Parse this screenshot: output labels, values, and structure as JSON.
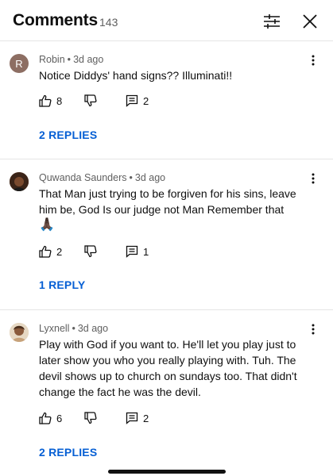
{
  "header": {
    "title": "Comments",
    "count": "143",
    "filter_icon": "sliders-icon",
    "close_icon": "close-icon"
  },
  "comments": [
    {
      "author": "Robin",
      "separator": "•",
      "time": "3d ago",
      "avatar_letter": "R",
      "text": "Notice Diddys' hand signs?? Illuminati!!",
      "likes": "8",
      "replies_count": "2",
      "view_replies": "2 REPLIES"
    },
    {
      "author": "Quwanda Saunders",
      "separator": "•",
      "time": "3d ago",
      "text": "That Man just trying to be forgiven for his sins, leave him be, God Is our judge not Man Remember that",
      "emoji": "🙏🏿",
      "likes": "2",
      "replies_count": "1",
      "view_replies": "1 REPLY"
    },
    {
      "author": "Lyxnell",
      "separator": "•",
      "time": "3d ago",
      "text": "Play with God if you want to. He'll let you play just to later show you who you really playing with. Tuh. The devil shows up to church on sundays too. That didn't change the fact he was the devil.",
      "likes": "6",
      "replies_count": "2",
      "view_replies": "2 REPLIES"
    }
  ],
  "colors": {
    "link": "#065fd4",
    "meta": "#606060",
    "divider": "#e5e5e5"
  }
}
